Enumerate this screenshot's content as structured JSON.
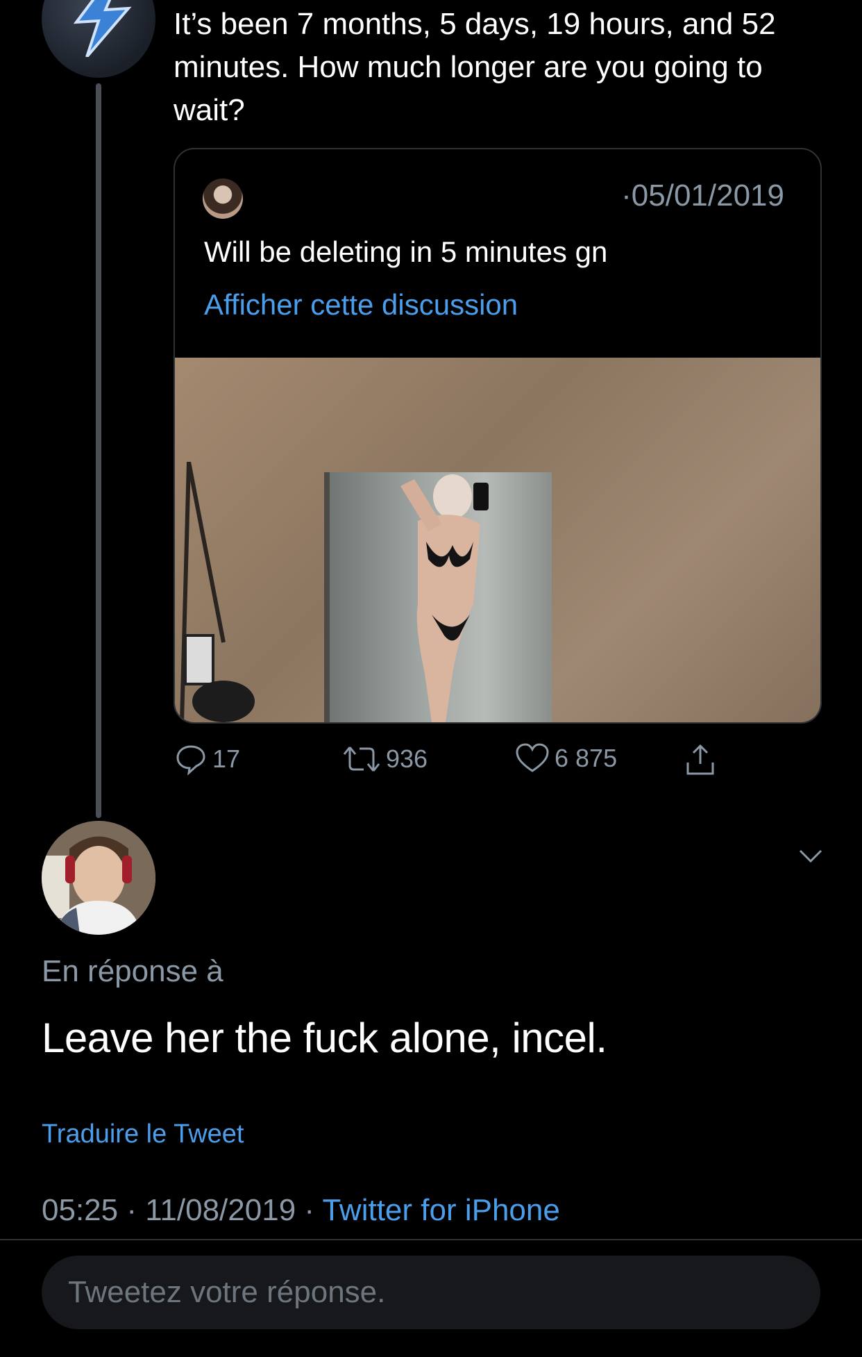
{
  "tweet": {
    "text": "It’s been 7 months, 5 days, 19 hours, and 52 minutes. How much longer are you going to wait?"
  },
  "quoted": {
    "date": "·05/01/2019",
    "text": "Will be deleting in 5 minutes gn",
    "show_thread": "Afficher cette discussion"
  },
  "actions": {
    "replies": "17",
    "retweets": "936",
    "likes": "6 875"
  },
  "reply": {
    "in_reply_to": "En réponse à",
    "text": "Leave her the fuck alone, incel.",
    "translate": "Traduire le Tweet",
    "time": "05:25 · 11/08/2019 · ",
    "source": "Twitter for iPhone"
  },
  "composer": {
    "placeholder": "Tweetez votre réponse."
  },
  "colors": {
    "background": "#000000",
    "link": "#4a9eeb",
    "muted": "#8b98a5"
  }
}
